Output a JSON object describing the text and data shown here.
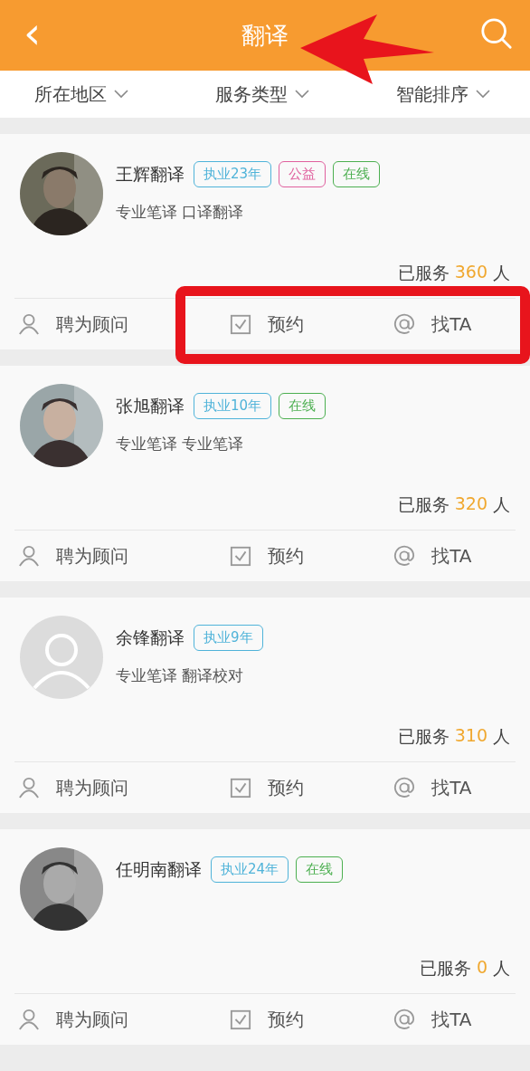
{
  "header": {
    "back": "‹",
    "title": "翻译",
    "annotation_arrow": true
  },
  "filters": [
    {
      "label": "所在地区"
    },
    {
      "label": "服务类型"
    },
    {
      "label": "智能排序"
    }
  ],
  "cards": [
    {
      "name": "王辉翻译",
      "avatar": {
        "kind": "picture"
      },
      "tags": [
        {
          "label": "执业23年",
          "color": "#4fb3d9"
        },
        {
          "label": "公益",
          "color": "#e0609e"
        },
        {
          "label": "在线",
          "color": "#4caf50"
        }
      ],
      "services": "专业笔译 口译翻译",
      "served_label": "已服务",
      "served_count": "360",
      "served_unit": "人",
      "actions": [
        "聘为顾问",
        "预约",
        "找TA"
      ],
      "highlighted": true
    },
    {
      "name": "张旭翻译",
      "avatar": {
        "kind": "picture"
      },
      "tags": [
        {
          "label": "执业10年",
          "color": "#4fb3d9"
        },
        {
          "label": "在线",
          "color": "#4caf50"
        }
      ],
      "services": "专业笔译 专业笔译",
      "served_label": "已服务",
      "served_count": "320",
      "served_unit": "人",
      "actions": [
        "聘为顾问",
        "预约",
        "找TA"
      ],
      "highlighted": false
    },
    {
      "name": "余锋翻译",
      "avatar": {
        "kind": "default"
      },
      "tags": [
        {
          "label": "执业9年",
          "color": "#4fb3d9"
        }
      ],
      "services": "专业笔译 翻译校对",
      "served_label": "已服务",
      "served_count": "310",
      "served_unit": "人",
      "actions": [
        "聘为顾问",
        "预约",
        "找TA"
      ],
      "highlighted": false
    },
    {
      "name": "任明南翻译",
      "avatar": {
        "kind": "picture"
      },
      "tags": [
        {
          "label": "执业24年",
          "color": "#4fb3d9"
        },
        {
          "label": "在线",
          "color": "#4caf50"
        }
      ],
      "served_label": "已服务",
      "served_count": "0",
      "served_unit": "人",
      "actions": [
        "聘为顾问",
        "预约",
        "找TA"
      ],
      "highlighted": false
    }
  ]
}
